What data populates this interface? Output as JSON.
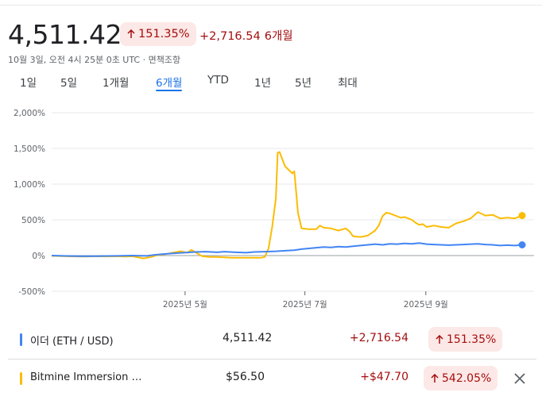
{
  "header": {
    "price": "4,511.42",
    "pct_change": "151.35%",
    "abs_change": "+2,716.54",
    "period": "6개월",
    "timestamp": "10월 3일, 오전 4시 25분 0초 UTC · 면책조항"
  },
  "tabs": [
    {
      "label": "1일",
      "active": false
    },
    {
      "label": "5일",
      "active": false
    },
    {
      "label": "1개월",
      "active": false
    },
    {
      "label": "6개월",
      "active": true
    },
    {
      "label": "YTD",
      "active": false
    },
    {
      "label": "1년",
      "active": false
    },
    {
      "label": "5년",
      "active": false
    },
    {
      "label": "최대",
      "active": false
    }
  ],
  "chart_data": {
    "type": "line",
    "yticks": [
      "2,000%",
      "1,500%",
      "1,000%",
      "500%",
      "0%",
      "-500%"
    ],
    "ylim": [
      -500,
      2000
    ],
    "xticks": [
      "2025년 5월",
      "2025년 7월",
      "2025년 9월"
    ],
    "grid": true,
    "series": [
      {
        "name": "이더 (ETH / USD)",
        "color": "#4285f4",
        "values": [
          [
            0,
            0
          ],
          [
            0.03,
            -5
          ],
          [
            0.08,
            -10
          ],
          [
            0.13,
            -8
          ],
          [
            0.18,
            -5
          ],
          [
            0.22,
            0
          ],
          [
            0.24,
            -2
          ],
          [
            0.26,
            -5
          ],
          [
            0.28,
            10
          ],
          [
            0.3,
            20
          ],
          [
            0.33,
            30
          ],
          [
            0.36,
            40
          ],
          [
            0.39,
            50
          ],
          [
            0.42,
            55
          ],
          [
            0.45,
            45
          ],
          [
            0.47,
            55
          ],
          [
            0.5,
            45
          ],
          [
            0.53,
            40
          ],
          [
            0.55,
            50
          ],
          [
            0.58,
            55
          ],
          [
            0.61,
            60
          ],
          [
            0.64,
            70
          ],
          [
            0.66,
            75
          ],
          [
            0.68,
            90
          ],
          [
            0.7,
            100
          ],
          [
            0.72,
            110
          ],
          [
            0.74,
            120
          ],
          [
            0.76,
            115
          ],
          [
            0.78,
            125
          ],
          [
            0.8,
            120
          ],
          [
            0.82,
            130
          ],
          [
            0.84,
            140
          ],
          [
            0.86,
            150
          ],
          [
            0.88,
            160
          ],
          [
            0.9,
            150
          ],
          [
            0.92,
            165
          ],
          [
            0.94,
            160
          ],
          [
            0.96,
            170
          ],
          [
            0.98,
            165
          ],
          [
            1.0,
            175
          ],
          [
            1.02,
            160
          ],
          [
            1.04,
            155
          ],
          [
            1.06,
            150
          ],
          [
            1.08,
            145
          ],
          [
            1.1,
            150
          ],
          [
            1.12,
            155
          ],
          [
            1.14,
            160
          ],
          [
            1.16,
            165
          ],
          [
            1.18,
            155
          ],
          [
            1.2,
            150
          ],
          [
            1.22,
            140
          ],
          [
            1.24,
            145
          ],
          [
            1.26,
            140
          ],
          [
            1.28,
            150
          ]
        ],
        "last_value": 151.35
      },
      {
        "name": "Bitmine Immersion …",
        "color": "#fbbc04",
        "values": [
          [
            0,
            -5
          ],
          [
            0.03,
            -8
          ],
          [
            0.06,
            -12
          ],
          [
            0.09,
            -15
          ],
          [
            0.12,
            -10
          ],
          [
            0.15,
            -12
          ],
          [
            0.18,
            -10
          ],
          [
            0.2,
            -15
          ],
          [
            0.22,
            -10
          ],
          [
            0.25,
            -40
          ],
          [
            0.27,
            -20
          ],
          [
            0.29,
            10
          ],
          [
            0.31,
            20
          ],
          [
            0.33,
            40
          ],
          [
            0.35,
            60
          ],
          [
            0.37,
            40
          ],
          [
            0.38,
            80
          ],
          [
            0.39,
            50
          ],
          [
            0.41,
            -10
          ],
          [
            0.43,
            -20
          ],
          [
            0.45,
            -20
          ],
          [
            0.47,
            -25
          ],
          [
            0.49,
            -30
          ],
          [
            0.51,
            -30
          ],
          [
            0.53,
            -30
          ],
          [
            0.55,
            -30
          ],
          [
            0.57,
            -30
          ],
          [
            0.58,
            -20
          ],
          [
            0.59,
            100
          ],
          [
            0.6,
            400
          ],
          [
            0.61,
            800
          ],
          [
            0.615,
            1440
          ],
          [
            0.62,
            1450
          ],
          [
            0.625,
            1380
          ],
          [
            0.635,
            1250
          ],
          [
            0.645,
            1200
          ],
          [
            0.655,
            1150
          ],
          [
            0.66,
            1180
          ],
          [
            0.665,
            900
          ],
          [
            0.67,
            600
          ],
          [
            0.68,
            380
          ],
          [
            0.7,
            370
          ],
          [
            0.72,
            370
          ],
          [
            0.73,
            420
          ],
          [
            0.74,
            390
          ],
          [
            0.76,
            380
          ],
          [
            0.78,
            350
          ],
          [
            0.8,
            380
          ],
          [
            0.81,
            340
          ],
          [
            0.82,
            270
          ],
          [
            0.84,
            260
          ],
          [
            0.86,
            280
          ],
          [
            0.88,
            350
          ],
          [
            0.89,
            420
          ],
          [
            0.9,
            550
          ],
          [
            0.91,
            600
          ],
          [
            0.92,
            590
          ],
          [
            0.94,
            550
          ],
          [
            0.95,
            530
          ],
          [
            0.96,
            540
          ],
          [
            0.97,
            520
          ],
          [
            0.98,
            500
          ],
          [
            0.99,
            460
          ],
          [
            1.0,
            430
          ],
          [
            1.01,
            440
          ],
          [
            1.02,
            400
          ],
          [
            1.04,
            420
          ],
          [
            1.06,
            400
          ],
          [
            1.08,
            390
          ],
          [
            1.1,
            450
          ],
          [
            1.12,
            480
          ],
          [
            1.14,
            520
          ],
          [
            1.16,
            610
          ],
          [
            1.18,
            560
          ],
          [
            1.2,
            570
          ],
          [
            1.22,
            520
          ],
          [
            1.24,
            530
          ],
          [
            1.26,
            520
          ],
          [
            1.28,
            560
          ]
        ],
        "last_value": 542.05
      }
    ]
  },
  "comparison": [
    {
      "name": "이더 (ETH / USD)",
      "color": "#4285f4",
      "price": "4,511.42",
      "change": "+2,716.54",
      "pct": "151.35%",
      "closable": false
    },
    {
      "name": "Bitmine Immersion …",
      "color": "#fbbc04",
      "price": "$56.50",
      "change": "+$47.70",
      "pct": "542.05%",
      "closable": true
    }
  ],
  "icons": {
    "up_arrow": "arrow-up-icon",
    "close": "close-icon"
  }
}
